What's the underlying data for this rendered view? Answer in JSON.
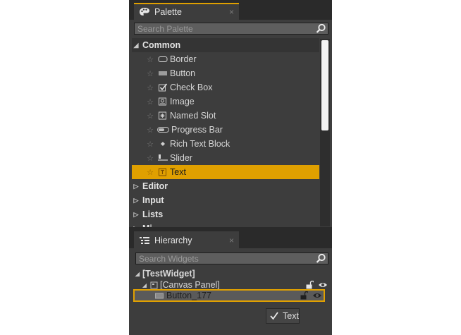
{
  "palette": {
    "tab_label": "Palette",
    "close_glyph": "×",
    "search_placeholder": "Search Palette",
    "categories": {
      "common": "Common",
      "editor": "Editor",
      "input": "Input",
      "lists": "Lists",
      "misc_partial": "Mi"
    },
    "items": [
      {
        "label": "Border",
        "icon": "border-icon"
      },
      {
        "label": "Button",
        "icon": "button-icon"
      },
      {
        "label": "Check Box",
        "icon": "checkbox-icon"
      },
      {
        "label": "Image",
        "icon": "image-icon"
      },
      {
        "label": "Named Slot",
        "icon": "named-slot-icon"
      },
      {
        "label": "Progress Bar",
        "icon": "progress-bar-icon"
      },
      {
        "label": "Rich Text Block",
        "icon": "rich-text-icon"
      },
      {
        "label": "Slider",
        "icon": "slider-icon"
      },
      {
        "label": "Text",
        "icon": "text-icon"
      }
    ],
    "selected_item": "Text"
  },
  "hierarchy": {
    "tab_label": "Hierarchy",
    "close_glyph": "×",
    "search_placeholder": "Search Widgets",
    "nodes": {
      "root": "[TestWidget]",
      "canvas": "[Canvas Panel]",
      "button": "Button_177"
    },
    "drag_preview_label": "Text"
  },
  "colors": {
    "accent": "#e0a000",
    "panel": "#3d3d3d",
    "background": "#2a2a2a"
  }
}
